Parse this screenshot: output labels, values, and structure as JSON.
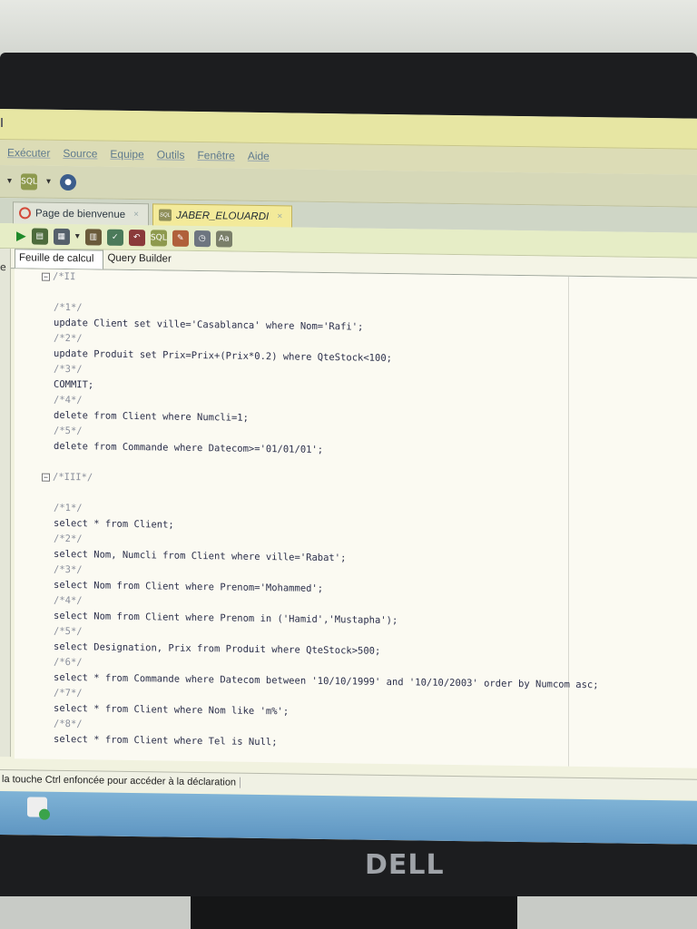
{
  "menu": {
    "items": [
      "Exécuter",
      "Source",
      "Equipe",
      "Outils",
      "Fenêtre",
      "Aide"
    ]
  },
  "tabs": [
    {
      "label": "Page de bienvenue",
      "active": false
    },
    {
      "label": "JABER_ELOUARDI",
      "active": true
    }
  ],
  "subtabs": {
    "worksheet": "Feuille de calcul",
    "query_builder": "Query Builder"
  },
  "gutter_letter": "e",
  "code_lines": [
    {
      "text": "/*II",
      "comment": true,
      "fold": true
    },
    {
      "text": "",
      "comment": false
    },
    {
      "text": "/*1*/",
      "comment": true
    },
    {
      "text": "update Client set ville='Casablanca' where Nom='Rafi';",
      "comment": false
    },
    {
      "text": "/*2*/",
      "comment": true
    },
    {
      "text": "update Produit set Prix=Prix+(Prix*0.2) where QteStock<100;",
      "comment": false
    },
    {
      "text": "/*3*/",
      "comment": true
    },
    {
      "text": "COMMIT;",
      "comment": false
    },
    {
      "text": "/*4*/",
      "comment": true
    },
    {
      "text": "delete from Client where Numcli=1;",
      "comment": false
    },
    {
      "text": "/*5*/",
      "comment": true
    },
    {
      "text": "delete from Commande where Datecom>='01/01/01';",
      "comment": false
    },
    {
      "text": "",
      "comment": false
    },
    {
      "text": "/*III*/",
      "comment": true,
      "fold": true
    },
    {
      "text": "",
      "comment": false
    },
    {
      "text": "/*1*/",
      "comment": true
    },
    {
      "text": "select * from Client;",
      "comment": false
    },
    {
      "text": "/*2*/",
      "comment": true
    },
    {
      "text": "select Nom, Numcli from Client where ville='Rabat';",
      "comment": false
    },
    {
      "text": "/*3*/",
      "comment": true
    },
    {
      "text": "select Nom from Client where Prenom='Mohammed';",
      "comment": false
    },
    {
      "text": "/*4*/",
      "comment": true
    },
    {
      "text": "select Nom from Client where Prenom in ('Hamid','Mustapha');",
      "comment": false
    },
    {
      "text": "/*5*/",
      "comment": true
    },
    {
      "text": "select Designation, Prix from Produit where QteStock>500;",
      "comment": false
    },
    {
      "text": "/*6*/",
      "comment": true
    },
    {
      "text": "select * from Commande where Datecom between '10/10/1999' and '10/10/2003' order by Numcom asc;",
      "comment": false
    },
    {
      "text": "/*7*/",
      "comment": true
    },
    {
      "text": "select * from Client where Nom like 'm%';",
      "comment": false
    },
    {
      "text": "/*8*/",
      "comment": true
    },
    {
      "text": "select * from Client where Tel is Null;",
      "comment": false
    }
  ],
  "status": {
    "text": "la touche Ctrl enfoncée pour accéder à la déclaration"
  },
  "brand": {
    "logo": "DELL"
  },
  "colors": {
    "tab_active": "#f3ea9a",
    "taskbar": "#6fa5cc",
    "code_keyword": "#1e2a80"
  }
}
